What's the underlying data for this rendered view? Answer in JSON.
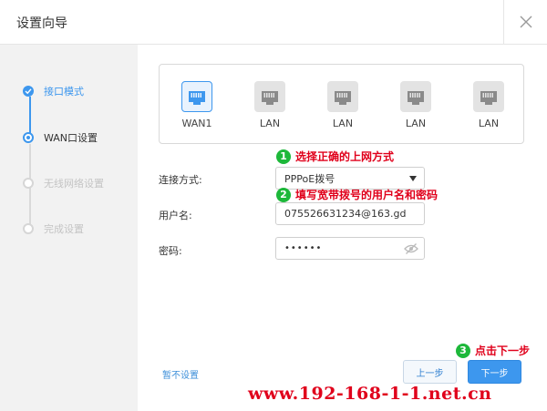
{
  "dialog": {
    "title": "设置向导"
  },
  "sidebar": {
    "steps": [
      {
        "label": "接口模式",
        "state": "done"
      },
      {
        "label": "WAN口设置",
        "state": "current"
      },
      {
        "label": "无线网络设置",
        "state": "pending"
      },
      {
        "label": "完成设置",
        "state": "pending"
      }
    ]
  },
  "ports": [
    {
      "label": "WAN1",
      "active": true
    },
    {
      "label": "LAN",
      "active": false
    },
    {
      "label": "LAN",
      "active": false
    },
    {
      "label": "LAN",
      "active": false
    },
    {
      "label": "LAN",
      "active": false
    }
  ],
  "form": {
    "connection_label": "连接方式:",
    "connection_value": "PPPoE拨号",
    "username_label": "用户名:",
    "username_value": "075526631234@163.gd",
    "password_label": "密码:",
    "password_masked": "••••••"
  },
  "annotations": {
    "a1_num": "1",
    "a1_text": "选择正确的上网方式",
    "a2_num": "2",
    "a2_text": "填写宽带拨号的用户名和密码",
    "a3_num": "3",
    "a3_text": "点击下一步"
  },
  "footer": {
    "skip_label": "暂不设置",
    "prev_label": "上一步",
    "next_label": "下一步"
  },
  "watermark": "www.192-168-1-1.net.cn",
  "colors": {
    "accent": "#3d97ee",
    "sidebar_bg": "#f2f2f2",
    "annotation_red": "#e0001b",
    "annotation_green": "#1db83a"
  }
}
